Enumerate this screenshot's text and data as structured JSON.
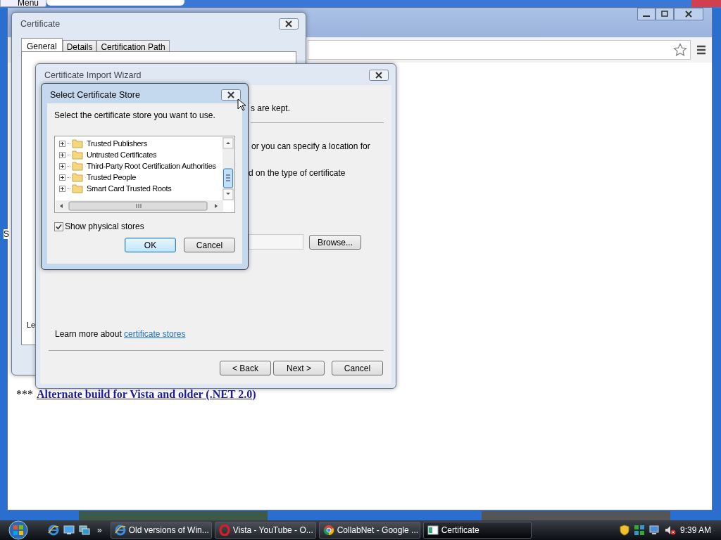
{
  "background_window": {
    "menu_label": "Menu"
  },
  "browser": {
    "page_fragment": "S",
    "link_prefix": "***",
    "link": "Alternate build for Vista and older (.NET 2.0)"
  },
  "certificate_window": {
    "title": "Certificate",
    "fragment": "Le",
    "tabs": [
      {
        "label": "General",
        "selected": true
      },
      {
        "label": "Details",
        "selected": false
      },
      {
        "label": "Certification Path",
        "selected": false
      }
    ]
  },
  "import_wizard": {
    "title": "Certificate Import Wizard",
    "text_fragments": [
      "s are kept.",
      "or you can specify a location for",
      "d on the type of certificate"
    ],
    "browse_button": "Browse...",
    "learn_more_prefix": "Learn more about",
    "learn_more_link": "certificate stores",
    "buttons": [
      "< Back",
      "Next >",
      "Cancel"
    ]
  },
  "select_store_dialog": {
    "title": "Select Certificate Store",
    "instruction": "Select the certificate store you want to use.",
    "stores": [
      {
        "label": "Trusted Publishers",
        "expanded": false
      },
      {
        "label": "Untrusted Certificates",
        "expanded": false
      },
      {
        "label": "Third-Party Root Certification Authorities",
        "expanded": false
      },
      {
        "label": "Trusted People",
        "expanded": false
      },
      {
        "label": "Smart Card Trusted Roots",
        "expanded": false
      }
    ],
    "show_physical_stores": {
      "label": "Show physical stores",
      "checked": true
    },
    "buttons": [
      {
        "label": "OK",
        "default": true
      },
      {
        "label": "Cancel",
        "default": false
      }
    ]
  },
  "taskbar": {
    "overflow": "»",
    "tasks": [
      {
        "label": "Old versions of Win...",
        "kind": "ie",
        "selected": false
      },
      {
        "label": "Vista - YouTube - O...",
        "kind": "opera",
        "selected": false
      },
      {
        "label": "CollabNet - Google ...",
        "kind": "chrome",
        "selected": false
      },
      {
        "label": "Certificate",
        "kind": "window",
        "selected": true
      }
    ],
    "time": "9:39 AM"
  }
}
